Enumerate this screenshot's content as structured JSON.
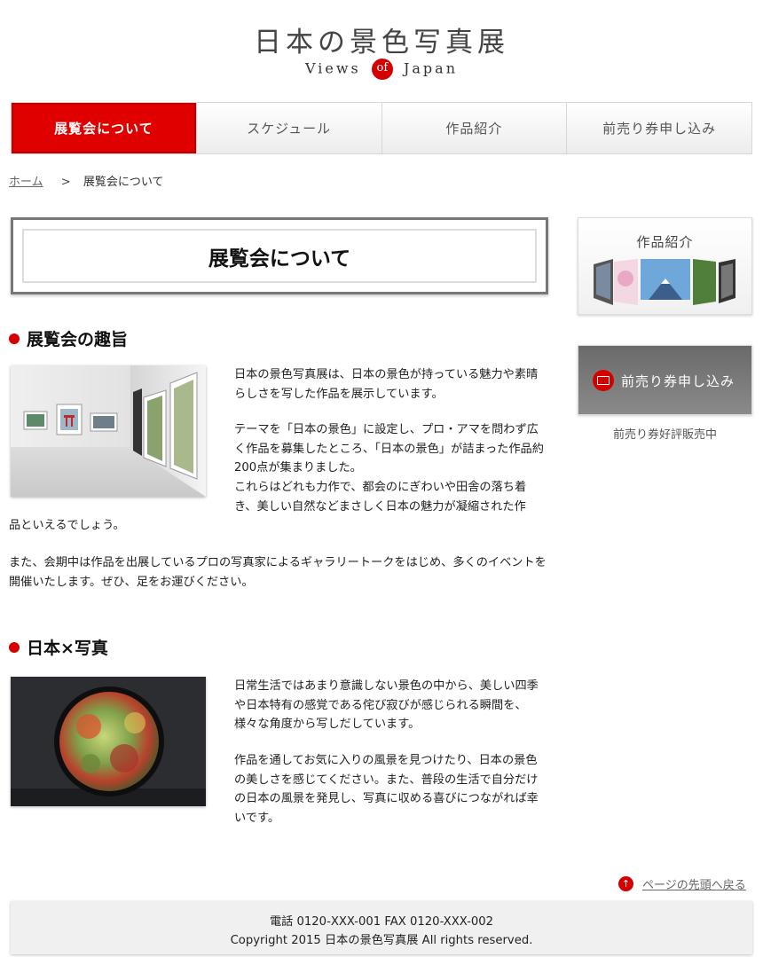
{
  "header": {
    "site_title": "日本の景色写真展",
    "subtitle_pre": "Views",
    "subtitle_of": "of",
    "subtitle_post": "Japan"
  },
  "nav": {
    "items": [
      {
        "label": "展覧会について"
      },
      {
        "label": "スケジュール"
      },
      {
        "label": "作品紹介"
      },
      {
        "label": "前売り券申し込み"
      }
    ]
  },
  "breadcrumb": {
    "home": "ホーム",
    "separator": ">",
    "current": "展覧会について"
  },
  "main": {
    "page_title": "展覧会について",
    "section1": {
      "heading": "展覧会の趣旨",
      "p1": "日本の景色写真展は、日本の景色が持っている魅力や素晴らしさを写した作品を展示しています。",
      "p2": "テーマを「日本の景色」に設定し、プロ・アマを問わず広く作品を募集したところ、「日本の景色」が詰まった作品約200点が集まりました。",
      "p3a": "これらはどれも力作で、都会のにぎわいや田舎の落ち着き、美しい自然などまさしく日本の魅力が凝縮された作",
      "p3b": "品といえるでしょう。",
      "p4": "また、会期中は作品を出展しているプロの写真家によるギャラリートークをはじめ、多くのイベントを開催いたします。ぜひ、足をお運びください。"
    },
    "section2": {
      "heading": "日本×写真",
      "p1": "日常生活ではあまり意識しない景色の中から、美しい四季や日本特有の感覚である侘び寂びが感じられる瞬間を、様々な角度から写しだしています。",
      "p2": "作品を通してお気に入りの風景を見つけたり、日本の景色の美しさを感じてください。また、普段の生活で自分だけの日本の風景を発見し、写真に収める喜びにつながれば幸いです。"
    }
  },
  "sidebar": {
    "works_label": "作品紹介",
    "ticket_label": "前売り券申し込み",
    "ticket_caption": "前売り券好評販売中"
  },
  "pagetop": {
    "label": "ページの先頭へ戻る"
  },
  "footer": {
    "contact": "電話 0120-XXX-001 FAX 0120-XXX-002",
    "copyright": "Copyright 2015 日本の景色写真展 All rights reserved."
  },
  "colors": {
    "accent": "#d40000",
    "nav_active": "#e00000"
  },
  "icons": [
    "ticket-icon",
    "arrow-up-icon"
  ]
}
